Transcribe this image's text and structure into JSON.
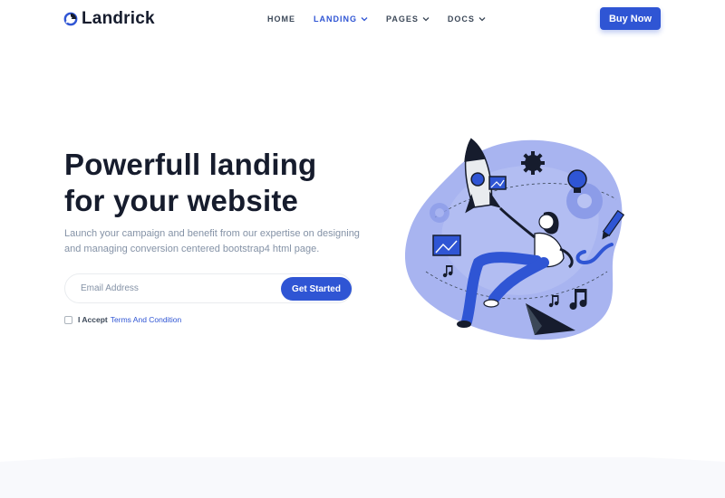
{
  "brand": {
    "name": "Landrick",
    "accent": "#2f55d4"
  },
  "nav": {
    "items": [
      {
        "label": "HOME",
        "dropdown": false,
        "active": false
      },
      {
        "label": "LANDING",
        "dropdown": true,
        "active": true
      },
      {
        "label": "PAGES",
        "dropdown": true,
        "active": false
      },
      {
        "label": "DOCS",
        "dropdown": true,
        "active": false
      }
    ],
    "cta": "Buy Now"
  },
  "hero": {
    "title_line1": "Powerfull landing",
    "title_line2": "for your website",
    "subtitle": "Launch your campaign and benefit from our expertise on designing and managing conversion centered bootstrap4 html page.",
    "email_placeholder": "Email Address",
    "submit": "Get Started",
    "accept_label": "I Accept",
    "terms_link": "Terms And Condition"
  },
  "icons": [
    "logo-icon",
    "chevron-down-icon",
    "checkbox-icon",
    "rocket-icon",
    "gear-icon",
    "lightbulb-icon",
    "image-icon",
    "music-note-icon",
    "paper-plane-icon",
    "pen-icon"
  ]
}
